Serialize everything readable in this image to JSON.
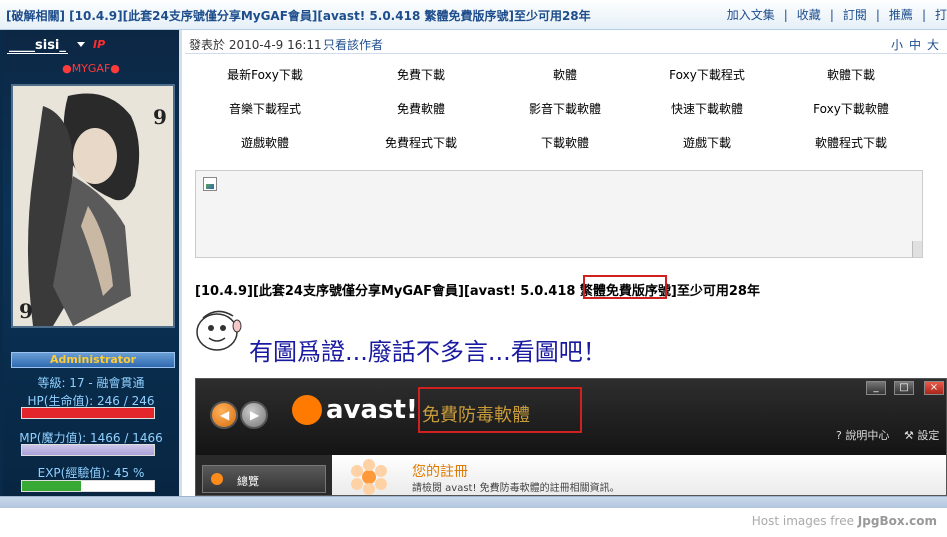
{
  "header": {
    "title": "[破解相關] [10.4.9][此套24支序號僅分享MyGAF會員][avast! 5.0.418 繁體免費版序號]至少可用28年",
    "actions": [
      "加入文集",
      "收藏",
      "訂閱",
      "推薦",
      "打"
    ]
  },
  "sidebar": {
    "username": "____sisi_",
    "ip_mark": "IP",
    "group": "●MYGAF●",
    "role": "Administrator",
    "level": "等級: 17 - 融會貫通",
    "hp": "HP(生命值): 246 / 246",
    "mp": "MP(魔力值): 1466 / 1466",
    "exp": "EXP(經驗值): 45 %",
    "exp_fraction": 0.45
  },
  "post": {
    "date": "發表於 2010-4-9 16:11",
    "author_only": "只看該作者",
    "font_sizes": [
      "小",
      "中",
      "大"
    ],
    "ad_links": [
      [
        "最新Foxy下載",
        "免費下載",
        "軟體",
        "Foxy下載程式",
        "軟體下載"
      ],
      [
        "音樂下載程式",
        "免費軟體",
        "影音下載軟體",
        "快速下載軟體",
        "Foxy下載軟體"
      ],
      [
        "遊戲軟體",
        "免費程式下載",
        "下載軟體",
        "遊戲下載",
        "軟體程式下載"
      ]
    ],
    "title_line": "[10.4.9][此套24支序號僅分享MyGAF會員][avast! 5.0.418 繁體免費版序號]至少可用28年",
    "big_line": "有圖爲證...廢話不多言...看圖吧！"
  },
  "screenshot": {
    "logo": "avast!",
    "label": "免費防毒軟體",
    "help": "說明中心",
    "settings": "設定",
    "nav_item": "總覽",
    "reg_title": "您的註冊",
    "reg_desc": "請檢閱 avast! 免費防毒軟體的註冊相關資訊。"
  },
  "footer": {
    "jpgbox_prefix": "Host images free",
    "jpgbox_brand": "JpgBox.com"
  }
}
